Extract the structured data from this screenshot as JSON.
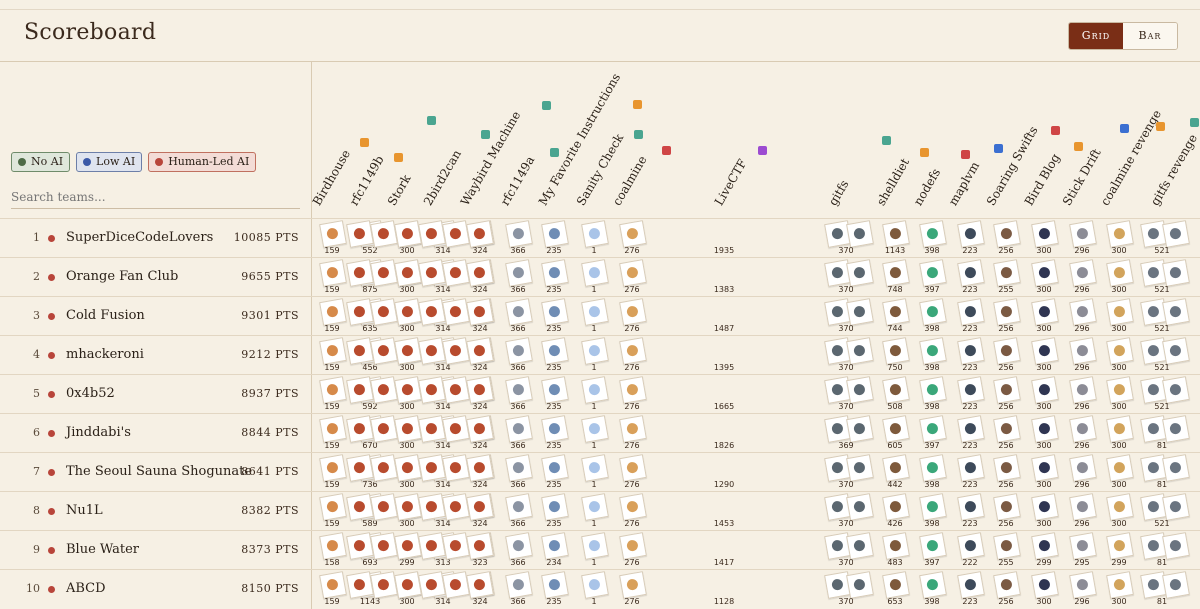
{
  "header": {
    "title": "Scoreboard",
    "view_toggle": [
      "Grid",
      "Bar"
    ],
    "active_view": "Grid"
  },
  "filters": [
    {
      "label": "No AI",
      "color": "#4d6b46"
    },
    {
      "label": "Low AI",
      "color": "#3b59a8"
    },
    {
      "label": "Human-Led AI",
      "color": "#b8453a"
    }
  ],
  "search": {
    "placeholder": "Search teams..."
  },
  "challenges": [
    "Birdhouse",
    "rfc1149b",
    "Stork",
    "2bird2can",
    "Waybird Machine",
    "rfc1149a",
    "My Favorite Instructions",
    "Sanity Check",
    "coalmine",
    "LiveCTF",
    "gitfs",
    "shelldiet",
    "nodefs",
    "maplvm",
    "Soaring Swifts",
    "Bird Blog",
    "Stick Drift",
    "coalmine revenge",
    "gitfs revenge"
  ],
  "teams": [
    {
      "rank": "1",
      "name": "SuperDiceCodeLovers",
      "points": "10085 PTS"
    },
    {
      "rank": "2",
      "name": "Orange Fan Club",
      "points": "9655 PTS"
    },
    {
      "rank": "3",
      "name": "Cold Fusion",
      "points": "9301 PTS"
    },
    {
      "rank": "4",
      "name": "mhackeroni",
      "points": "9212 PTS"
    },
    {
      "rank": "5",
      "name": "0x4b52",
      "points": "8937 PTS"
    },
    {
      "rank": "6",
      "name": "Jinddabi's",
      "points": "8844 PTS"
    },
    {
      "rank": "7",
      "name": "The Seoul Sauna Shogunate",
      "points": "8641 PTS"
    },
    {
      "rank": "8",
      "name": "Nu1L",
      "points": "8382 PTS"
    },
    {
      "rank": "9",
      "name": "Blue Water",
      "points": "8373 PTS"
    },
    {
      "rank": "10",
      "name": "ABCD",
      "points": "8150 PTS"
    }
  ],
  "scores": [
    [
      "159",
      "552",
      "300",
      "314",
      "324",
      "366",
      "235",
      "1",
      "276",
      "1935",
      "370",
      "1143",
      "398",
      "223",
      "256",
      "300",
      "296",
      "300",
      "521"
    ],
    [
      "159",
      "875",
      "300",
      "314",
      "324",
      "366",
      "235",
      "1",
      "276",
      "1383",
      "370",
      "748",
      "397",
      "223",
      "255",
      "300",
      "296",
      "300",
      "521"
    ],
    [
      "159",
      "635",
      "300",
      "314",
      "324",
      "366",
      "235",
      "1",
      "276",
      "1487",
      "370",
      "744",
      "398",
      "223",
      "256",
      "300",
      "296",
      "300",
      "521"
    ],
    [
      "159",
      "456",
      "300",
      "314",
      "324",
      "366",
      "235",
      "1",
      "276",
      "1395",
      "370",
      "750",
      "398",
      "223",
      "256",
      "300",
      "296",
      "300",
      "521"
    ],
    [
      "159",
      "592",
      "300",
      "314",
      "324",
      "366",
      "235",
      "1",
      "276",
      "1665",
      "370",
      "508",
      "398",
      "223",
      "256",
      "300",
      "296",
      "300",
      "521"
    ],
    [
      "159",
      "670",
      "300",
      "314",
      "324",
      "366",
      "235",
      "1",
      "276",
      "1826",
      "369",
      "605",
      "397",
      "223",
      "256",
      "300",
      "296",
      "300",
      "81"
    ],
    [
      "159",
      "736",
      "300",
      "314",
      "324",
      "366",
      "235",
      "1",
      "276",
      "1290",
      "370",
      "442",
      "398",
      "223",
      "256",
      "300",
      "296",
      "300",
      "81"
    ],
    [
      "159",
      "589",
      "300",
      "314",
      "324",
      "366",
      "235",
      "1",
      "276",
      "1453",
      "370",
      "426",
      "398",
      "223",
      "256",
      "300",
      "296",
      "300",
      "521"
    ],
    [
      "158",
      "693",
      "299",
      "313",
      "323",
      "366",
      "234",
      "1",
      "276",
      "1417",
      "370",
      "483",
      "397",
      "222",
      "255",
      "299",
      "295",
      "299",
      "81"
    ],
    [
      "159",
      "1143",
      "300",
      "314",
      "324",
      "366",
      "235",
      "1",
      "276",
      "1128",
      "370",
      "653",
      "398",
      "223",
      "256",
      "300",
      "296",
      "300",
      "81"
    ]
  ]
}
